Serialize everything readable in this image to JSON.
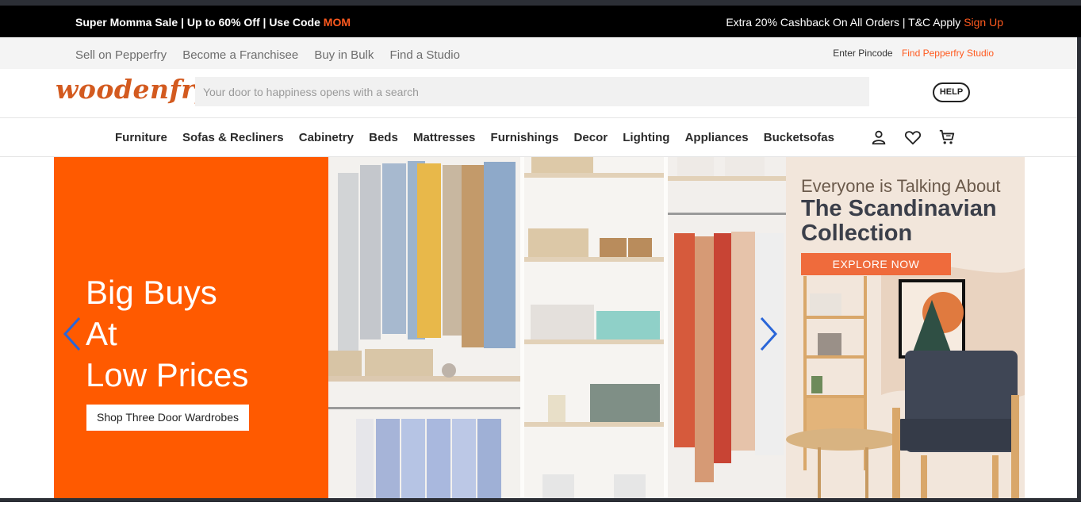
{
  "promo": {
    "left_prefix": "Super Momma Sale | Up to 60% Off | Use Code ",
    "left_code": "MOM",
    "right_prefix": "Extra 20% Cashback On All Orders | T&C Apply ",
    "right_link": "Sign Up"
  },
  "utility": {
    "links": [
      "Sell on Pepperfry",
      "Become a Franchisee",
      "Buy in Bulk",
      "Find a Studio"
    ],
    "pincode": "Enter Pincode",
    "studio": "Find Pepperfry Studio"
  },
  "header": {
    "logo": "woodenfry",
    "search_placeholder": "Your door to happiness opens with a search",
    "help": "HELP"
  },
  "nav": {
    "items": [
      "Furniture",
      "Sofas & Recliners",
      "Cabinetry",
      "Beds",
      "Mattresses",
      "Furnishings",
      "Decor",
      "Lighting",
      "Appliances",
      "Bucketsofas"
    ],
    "icons": [
      "user-icon",
      "heart-icon",
      "cart-icon"
    ]
  },
  "banner": {
    "headline": [
      "Big Buys",
      "At",
      "Low Prices"
    ],
    "cta": "Shop Three Door Wardrobes",
    "right_small": "Everyone is Talking About",
    "right_big": [
      "The Scandinavian",
      "Collection"
    ],
    "explore": "EXPLORE NOW"
  },
  "colors": {
    "accent": "#ff5a1f",
    "banner_orange": "#ff5a00",
    "arrow": "#2a66d8"
  }
}
